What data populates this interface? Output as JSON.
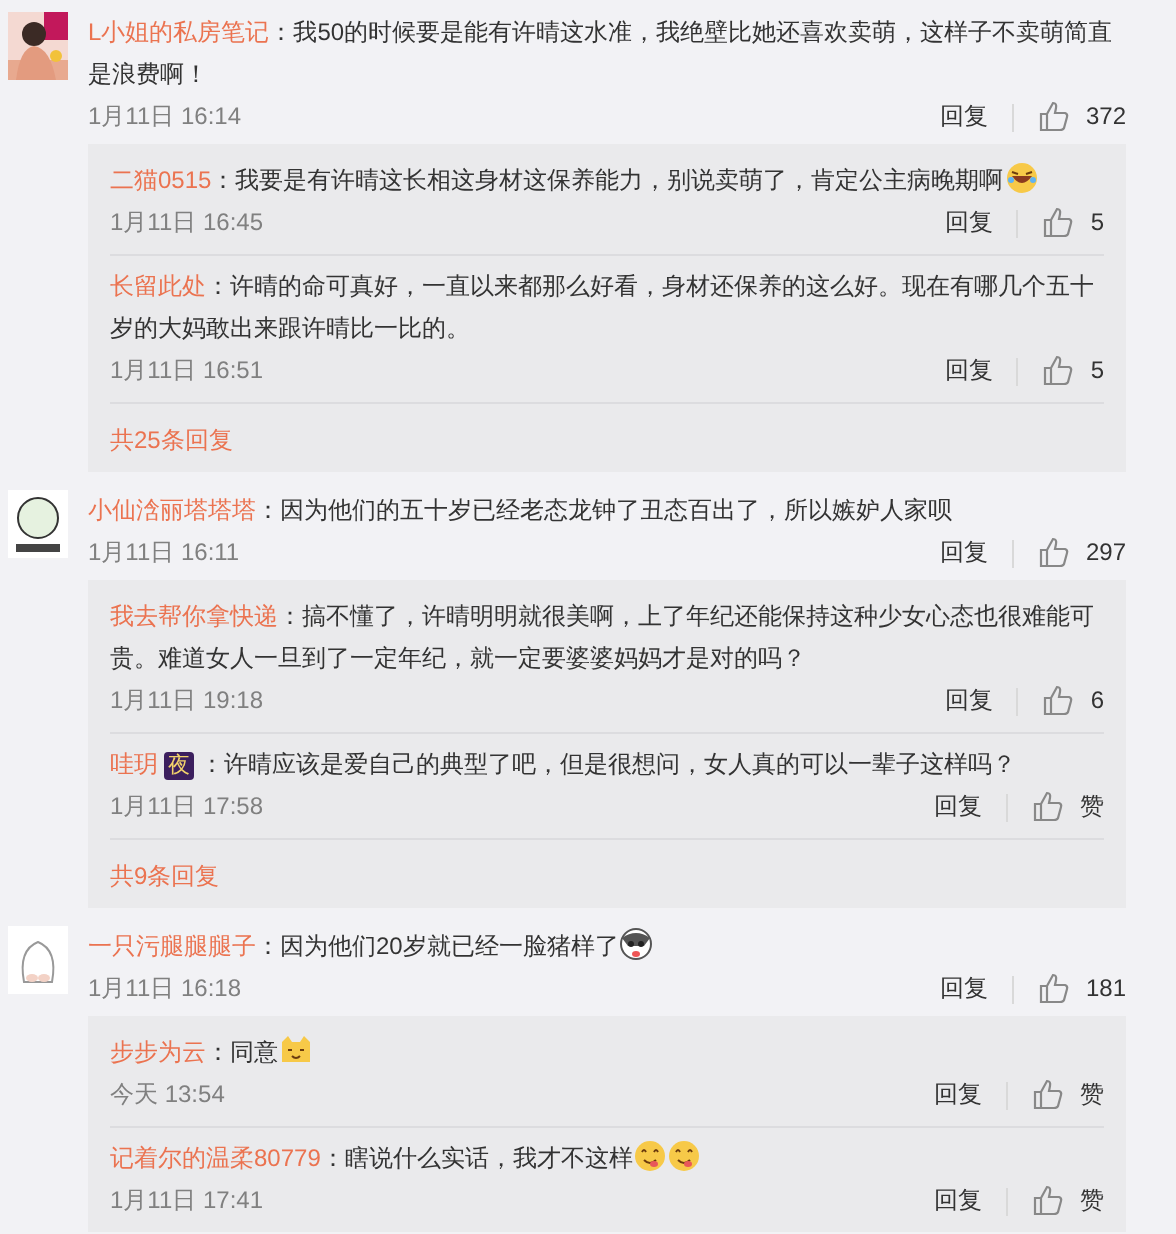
{
  "comments": [
    {
      "avatar": {
        "kind": "picture"
      },
      "name": "L小姐的私房笔记",
      "text": "：我50的时候要是能有许晴这水准，我绝壁比她还喜欢卖萌，这样子不卖萌简直是浪费啊！",
      "time": "1月11日 16:14",
      "reply_label": "回复",
      "likes": "372",
      "replies": [
        {
          "name": "二猫0515",
          "text": "：我要是有许晴这长相这身材这保养能力，别说卖萌了，肯定公主病晚期啊",
          "emojis": [
            {
              "kind": "laughing"
            }
          ],
          "time": "1月11日 16:45",
          "reply_label": "回复",
          "likes": "5"
        },
        {
          "name": "长留此处",
          "text": "：许晴的命可真好，一直以来都那么好看，身材还保养的这么好。现在有哪几个五十岁的大妈敢出来跟许晴比一比的。",
          "time": "1月11日 16:51",
          "reply_label": "回复",
          "likes": "5"
        }
      ],
      "more_replies": "共25条回复"
    },
    {
      "avatar": {
        "kind": "picture"
      },
      "name": "小仙浛丽塔塔塔",
      "text": "：因为他们的五十岁已经老态龙钟了丑态百出了，所以嫉妒人家呗",
      "time": "1月11日 16:11",
      "reply_label": "回复",
      "likes": "297",
      "replies": [
        {
          "name": "我去帮你拿快递",
          "text": "：搞不懂了，许晴明明就很美啊，上了年纪还能保持这种少女心态也很难能可贵。难道女人一旦到了一定年纪，就一定要婆婆妈妈才是对的吗？",
          "time": "1月11日 19:18",
          "reply_label": "回复",
          "likes": "6"
        },
        {
          "name": "哇玥",
          "badge": "夜",
          "text": "：许晴应该是爱自己的典型了吧，但是很想问，女人真的可以一辈子这样吗？",
          "time": "1月11日 17:58",
          "reply_label": "回复",
          "likes": "赞"
        }
      ],
      "more_replies": "共9条回复"
    },
    {
      "avatar": {
        "kind": "picture"
      },
      "name": "一只污腿腿腿子",
      "text": "：因为他们20岁就已经一脸猪样了",
      "emojis": [
        {
          "kind": "husky"
        }
      ],
      "time": "1月11日 16:18",
      "reply_label": "回复",
      "likes": "181",
      "replies": [
        {
          "name": "步步为云",
          "text": "：同意",
          "emojis": [
            {
              "kind": "cat"
            }
          ],
          "time": "今天 13:54",
          "reply_label": "回复",
          "likes": "赞"
        },
        {
          "name": "记着尔的温柔80779",
          "text": "：瞎说什么实话，我才不这样",
          "emojis": [
            {
              "kind": "yummy"
            },
            {
              "kind": "yummy"
            }
          ],
          "time": "1月11日 17:41",
          "reply_label": "回复",
          "likes": "赞"
        }
      ]
    }
  ]
}
